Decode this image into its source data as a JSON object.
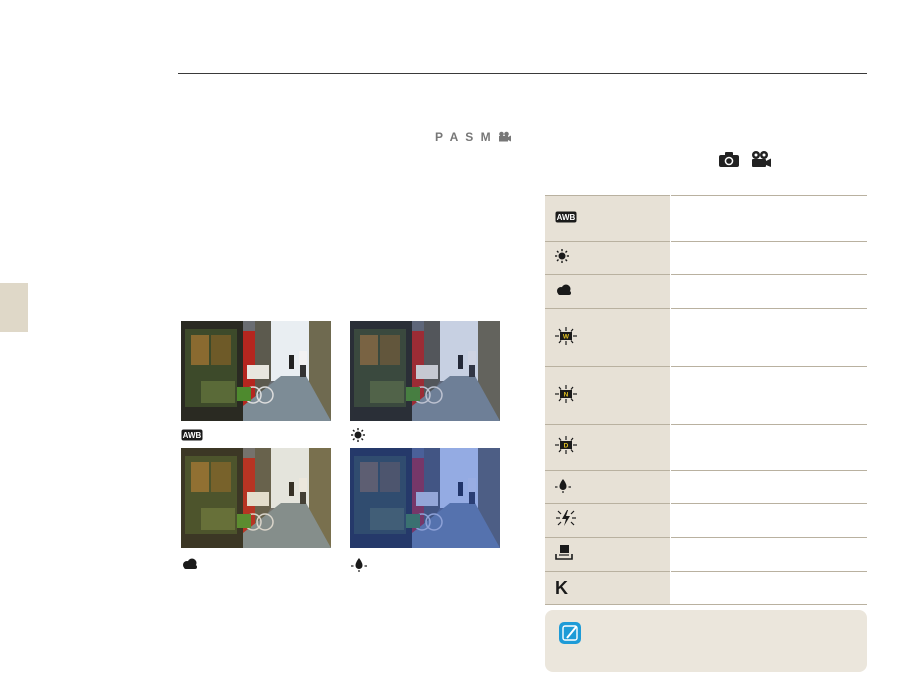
{
  "header": {
    "mode_icons_label": "P A S M"
  },
  "photos": [
    {
      "caption_icon": "awb-icon",
      "tint": "#000000",
      "tint_opacity": 0.0
    },
    {
      "caption_icon": "daylight-icon",
      "tint": "#2a4a9a",
      "tint_opacity": 0.18
    },
    {
      "caption_icon": "cloudy-icon",
      "tint": "#c89a40",
      "tint_opacity": 0.12
    },
    {
      "caption_icon": "tungsten-icon",
      "tint": "#1e4fd0",
      "tint_opacity": 0.42
    }
  ],
  "wb_table": {
    "rows": [
      {
        "icon": "awb-icon"
      },
      {
        "icon": "daylight-icon"
      },
      {
        "icon": "cloudy-icon"
      },
      {
        "icon": "fluorescent-w-icon",
        "letter": "W"
      },
      {
        "icon": "fluorescent-n-icon",
        "letter": "N"
      },
      {
        "icon": "fluorescent-d-icon",
        "letter": "D"
      },
      {
        "icon": "tungsten-icon"
      },
      {
        "icon": "flash-wb-icon"
      },
      {
        "icon": "custom-wb-icon"
      },
      {
        "icon": "kelvin-icon",
        "letter": "K"
      }
    ]
  },
  "note": {
    "icon": "memo-pencil-icon"
  },
  "colors": {
    "table_shade": "#e7e1d6",
    "table_rule": "#b9b1a0",
    "note_bg": "#ebe6dc",
    "note_icon": "#1e9bd7",
    "side_tab": "#dfd8c8"
  }
}
